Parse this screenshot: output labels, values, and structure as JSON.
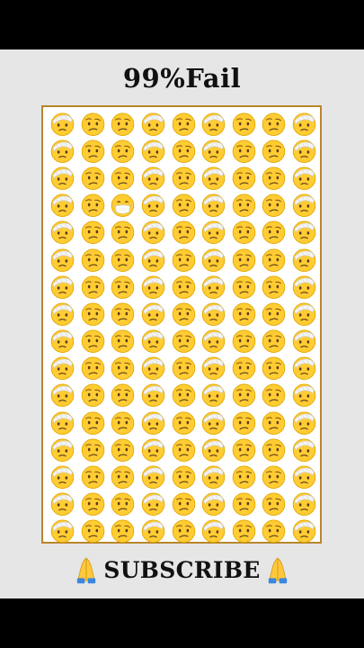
{
  "title": "99%Fail",
  "footer": {
    "label": "SUBSCRIBE",
    "left_icon": "folded-hands-icon",
    "right_icon": "folded-hands-icon"
  },
  "puzzle": {
    "columns": 9,
    "rows": 16,
    "emoji_pattern_rows": [
      [
        "bandage",
        "confused",
        "confused",
        "bandage",
        "confused",
        "bandage",
        "confused",
        "confused",
        "bandage"
      ],
      [
        "bandage",
        "confused",
        "confused",
        "bandage",
        "confused",
        "bandage",
        "confused",
        "confused",
        "bandage"
      ],
      [
        "bandage",
        "confused",
        "confused",
        "bandage",
        "confused",
        "bandage",
        "confused",
        "confused",
        "bandage"
      ],
      [
        "bandage",
        "confused",
        "mask",
        "bandage",
        "confused",
        "bandage",
        "confused",
        "confused",
        "bandage"
      ]
    ],
    "odd_one": "face-with-medical-mask"
  },
  "colors": {
    "background": "#e6e6e6",
    "letterbox": "#000000",
    "frame": "#b8862b",
    "emoji_face": "#ffcc33",
    "emoji_outline": "#e0a800",
    "bandage": "#f4f4f4"
  }
}
